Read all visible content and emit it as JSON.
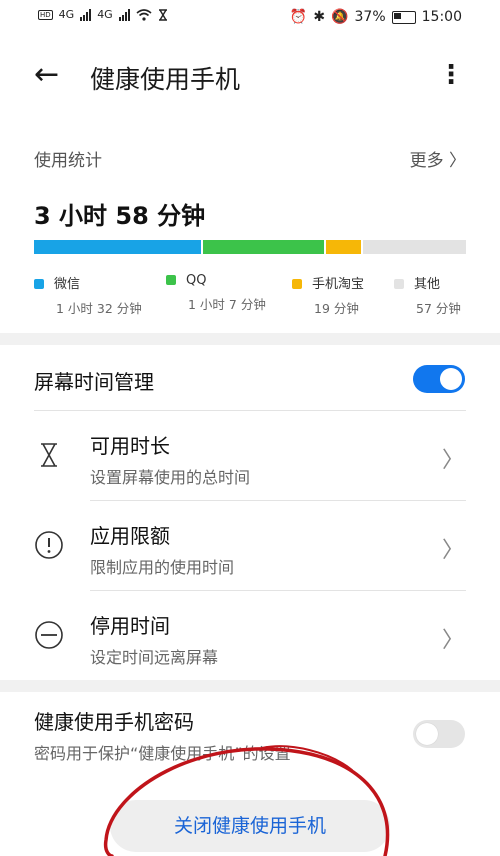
{
  "status_bar": {
    "left_badges": [
      "HD",
      "4G",
      "4G"
    ],
    "battery": "37%",
    "time": "15:00",
    "icons": [
      "alarm-icon",
      "bluetooth-icon",
      "mute-icon",
      "battery-icon"
    ]
  },
  "app_bar": {
    "title": "健康使用手机",
    "back_icon": "arrow-left-icon",
    "menu_icon": "more-vertical-icon"
  },
  "stats": {
    "header": "使用统计",
    "more_label": "更多",
    "total": "3 小时 58 分钟",
    "segments": [
      {
        "name": "微信",
        "duration": "1 小时 32 分钟",
        "minutes": 92,
        "color": "#18a3e6"
      },
      {
        "name": "QQ",
        "duration": "1 小时 7 分钟",
        "minutes": 67,
        "color": "#3cc34a"
      },
      {
        "name": "手机淘宝",
        "duration": "19 分钟",
        "minutes": 19,
        "color": "#f6b707"
      },
      {
        "name": "其他",
        "duration": "57 分钟",
        "minutes": 57,
        "color": "#e3e3e3"
      }
    ]
  },
  "screen_time": {
    "title": "屏幕时间管理",
    "enabled": true,
    "items": [
      {
        "title": "可用时长",
        "subtitle": "设置屏幕使用的总时间",
        "icon": "hourglass-icon"
      },
      {
        "title": "应用限额",
        "subtitle": "限制应用的使用时间",
        "icon": "alert-circle-icon"
      },
      {
        "title": "停用时间",
        "subtitle": "设定时间远离屏幕",
        "icon": "minus-circle-icon"
      }
    ]
  },
  "password": {
    "title": "健康使用手机密码",
    "subtitle": "密码用于保护“健康使用手机”的设置",
    "enabled": false
  },
  "footer": {
    "close_button": "关闭健康使用手机"
  },
  "colors": {
    "accent": "#1177ee",
    "button_text": "#1a64d6",
    "annotation": "#c0141a"
  }
}
